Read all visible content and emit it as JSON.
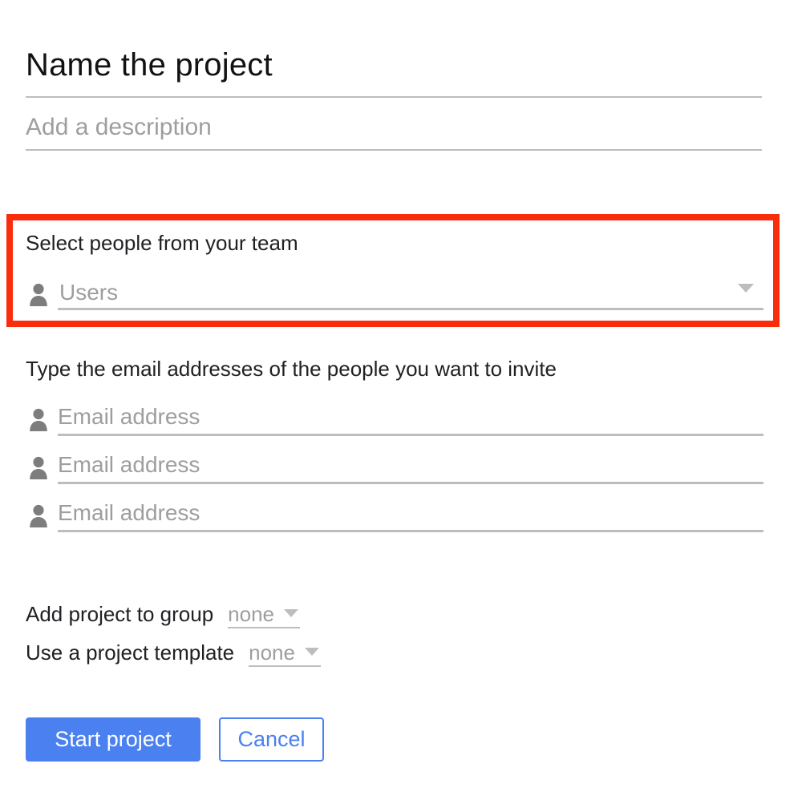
{
  "form": {
    "title_placeholder": "Name the project",
    "description_placeholder": "Add a description",
    "team_section": {
      "label": "Select people from your team",
      "users_placeholder": "Users",
      "icon": "person-icon",
      "caret_icon": "chevron-down-icon"
    },
    "invite_section": {
      "label": "Type the email addresses of the people you want to invite",
      "fields": [
        {
          "placeholder": "Email address",
          "icon": "person-icon"
        },
        {
          "placeholder": "Email address",
          "icon": "person-icon"
        },
        {
          "placeholder": "Email address",
          "icon": "person-icon"
        }
      ]
    },
    "options": [
      {
        "label": "Add project to group",
        "value": "none",
        "caret_icon": "chevron-down-icon"
      },
      {
        "label": "Use a project template",
        "value": "none",
        "caret_icon": "chevron-down-icon"
      }
    ],
    "actions": {
      "primary_label": "Start project",
      "secondary_label": "Cancel"
    }
  },
  "annotation": {
    "highlight_color": "#f92c0c"
  },
  "colors": {
    "accent_blue": "#4a80f0",
    "placeholder_gray": "#9e9e9e",
    "rule_gray": "#bdbdbd",
    "text_dark": "#202124"
  }
}
